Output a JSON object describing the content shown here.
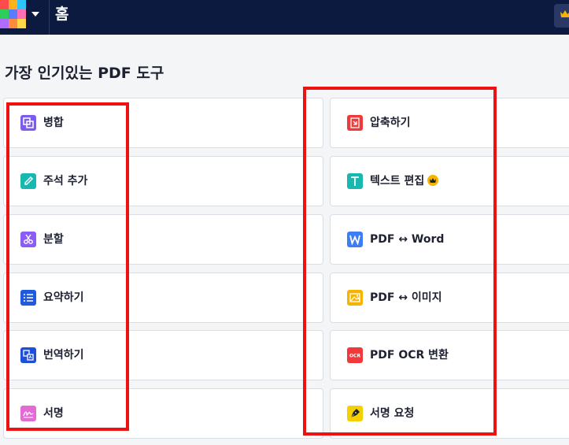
{
  "header": {
    "title": "홈",
    "logo_colors": [
      "#ff4b4b",
      "#ffb21e",
      "#2ec5ff",
      "#2dcf5a",
      "#5a7dff",
      "#ff6fb4",
      "#b06bff",
      "#ff8a3d",
      "#ffd84a"
    ],
    "bg_color": "#0c1a3f",
    "premium_icon": "crown-icon"
  },
  "section": {
    "title": "가장 인기있는 PDF 도구"
  },
  "tools_left": [
    {
      "label": "병합",
      "icon": "merge-icon",
      "color": "#7c5cf0"
    },
    {
      "label": "주석 추가",
      "icon": "pencil-icon",
      "color": "#17b8b0"
    },
    {
      "label": "분할",
      "icon": "scissors-icon",
      "color": "#8b5cf6"
    },
    {
      "label": "요약하기",
      "icon": "list-icon",
      "color": "#1f5ae0"
    },
    {
      "label": "번역하기",
      "icon": "translate-icon",
      "color": "#1f4fd8"
    },
    {
      "label": "서명",
      "icon": "signature-icon",
      "color": "#e36bd4"
    }
  ],
  "tools_right": [
    {
      "label": "압축하기",
      "icon": "compress-icon",
      "color": "#ee3a3a"
    },
    {
      "label": "텍스트 편집",
      "icon": "text-edit-icon",
      "color": "#17b8b0",
      "premium": true
    },
    {
      "label": "PDF ↔ Word",
      "icon": "word-icon",
      "color": "#3d7ef5"
    },
    {
      "label": "PDF ↔ 이미지",
      "icon": "image-icon",
      "color": "#f5b400"
    },
    {
      "label": "PDF OCR 변환",
      "icon": "ocr-icon",
      "color": "#ee3a3a"
    },
    {
      "label": "서명 요청",
      "icon": "pen-nib-icon",
      "color": "#f5d000"
    }
  ],
  "highlight_color": "#ee1111"
}
